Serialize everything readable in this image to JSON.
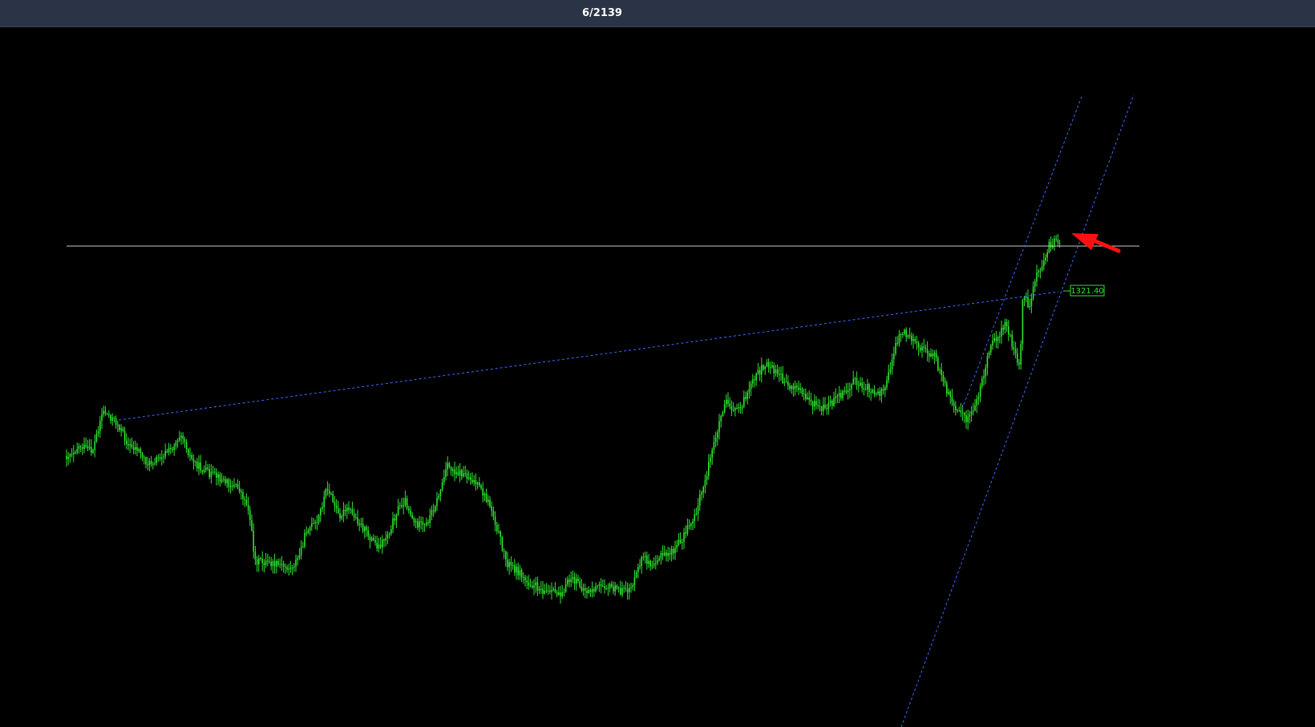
{
  "header": {
    "counter": "6/2139"
  },
  "chart": {
    "price_label": "1321.40",
    "colors": {
      "background": "#000000",
      "topbar": "#2b3447",
      "candle": "#2ee62e",
      "trendline": "#3d6bff",
      "horizontal_line": "#c8c8c8",
      "price_tag": "#2ee62e",
      "arrow": "#ff1010"
    }
  }
}
